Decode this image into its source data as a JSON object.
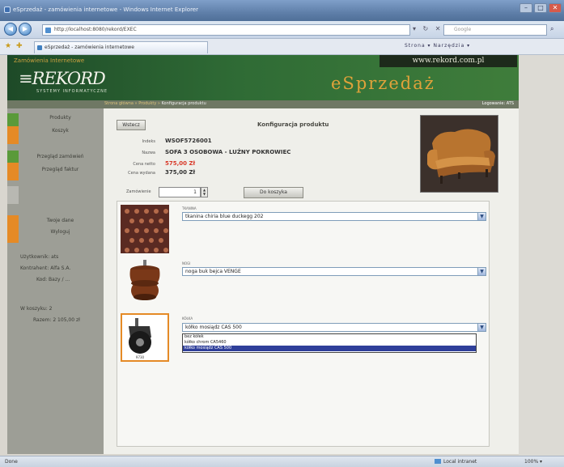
{
  "browser": {
    "title": "eSprzedaż - zamówienia internetowe - Windows Internet Explorer",
    "url": "http://localhost:8080/rekord/EXEC",
    "search_placeholder": "Google",
    "tab_label": "eSprzedaż - zamówienia internetowe",
    "commandbar": "Strona ▾  Narzędzia ▾",
    "status": "Done",
    "zone": "Local intranet",
    "zoom": "100% ▾"
  },
  "banner": {
    "company": "Zamówienia Internetowe",
    "logo": "≡REKORD",
    "logo_sub": "SYSTEMY INFORMATYCZNE",
    "url": "www.rekord.com.pl",
    "app": "eSprzedaż"
  },
  "breadcrumb": {
    "items": [
      "Strona główna »",
      "Produkty »"
    ],
    "current": "Konfiguracja produktu",
    "login": "Logowanie: ATS"
  },
  "sidebar": {
    "menu": [
      {
        "label": "Produkty",
        "color": "#5a9a3a"
      },
      {
        "label": "Koszyk",
        "color": "#e58a26"
      },
      {
        "label": "Przegląd zamówień",
        "color": "#5a9a3a"
      },
      {
        "label": "Przegląd faktur",
        "color": "#e58a26"
      },
      {
        "label": "",
        "color": "#b8b8b2"
      },
      {
        "label": "Twoje dane",
        "color": "#e58a26"
      },
      {
        "label": "Wyloguj",
        "color": "#e58a26"
      }
    ],
    "user_label": "Użytkownik: ",
    "user_value": "ats",
    "client_label": "Kontrahent: ",
    "client_value": "Alfa S.A.",
    "code_label": "Kod: ",
    "code_value": "Bazy / ...",
    "cart_label": "W koszyku: ",
    "cart_value": "2",
    "sum_label": "Razem: ",
    "sum_value": "2 105,00 zł"
  },
  "product": {
    "back_label": "Wstecz",
    "title": "Konfiguracja produktu",
    "index_label": "Indeks",
    "index_value": "WSOF5726001",
    "name_label": "Nazwa",
    "name_value": "SOFA 3 OSOBOWA - LUŹNY POKROWIEC",
    "net_label": "Cena netto",
    "net_value": "575,00 Zł",
    "gross_label": "Cena wydana",
    "gross_value": "375,00 Zł",
    "qty_label": "Zamówienie",
    "qty_value": "1",
    "add_to_cart": "Do koszyka"
  },
  "options": [
    {
      "label": "TKANINA",
      "selected": "tkanina chiria blue duckegg 202"
    },
    {
      "label": "NOGI",
      "selected": "noga buk bejca VENGE"
    },
    {
      "label": "KÓŁKA",
      "selected": "kółko mosiądz CAS 500"
    }
  ],
  "dropdown_open": [
    "bez kółek",
    "kółko chrom CA5460",
    "kółko mosiądz CAS 500"
  ],
  "wheel_code": "9730"
}
